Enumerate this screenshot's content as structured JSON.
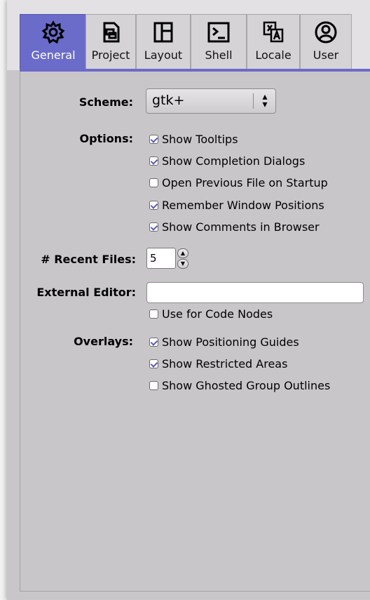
{
  "tabs": [
    {
      "label": "General",
      "icon": "gear-icon",
      "active": true
    },
    {
      "label": "Project",
      "icon": "project-icon",
      "active": false
    },
    {
      "label": "Layout",
      "icon": "layout-icon",
      "active": false
    },
    {
      "label": "Shell",
      "icon": "terminal-icon",
      "active": false
    },
    {
      "label": "Locale",
      "icon": "translate-icon",
      "active": false
    },
    {
      "label": "User",
      "icon": "user-icon",
      "active": false
    }
  ],
  "scheme": {
    "label": "Scheme:",
    "value": "gtk+"
  },
  "options": {
    "label": "Options:",
    "items": [
      {
        "label": "Show Tooltips",
        "checked": true
      },
      {
        "label": "Show Completion Dialogs",
        "checked": true
      },
      {
        "label": "Open Previous File on Startup",
        "checked": false
      },
      {
        "label": "Remember Window Positions",
        "checked": true
      },
      {
        "label": "Show Comments in Browser",
        "checked": true
      }
    ]
  },
  "recent_files": {
    "label": "# Recent Files:",
    "value": "5"
  },
  "external_editor": {
    "label": "External Editor:",
    "value": "",
    "use_for_code_nodes": {
      "label": "Use for Code Nodes",
      "checked": false
    }
  },
  "overlays": {
    "label": "Overlays:",
    "items": [
      {
        "label": "Show Positioning Guides",
        "checked": true
      },
      {
        "label": "Show Restricted Areas",
        "checked": true
      },
      {
        "label": "Show Ghosted Group Outlines",
        "checked": false
      }
    ]
  },
  "colors": {
    "accent": "#6b6bc9",
    "panel_bg": "#c9c6ca"
  }
}
